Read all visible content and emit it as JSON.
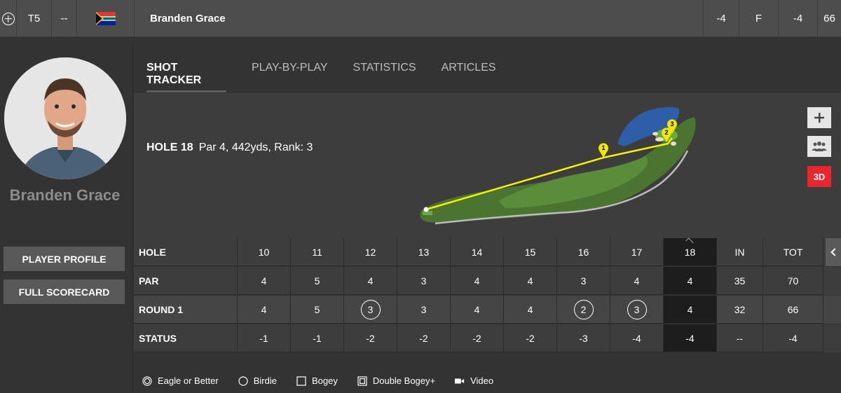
{
  "topbar": {
    "position": "T5",
    "movement": "--",
    "flag_icon": "south-africa-flag-icon",
    "player_name": "Branden Grace",
    "today": "-4",
    "thru": "F",
    "total": "-4",
    "strokes": "66"
  },
  "sidebar": {
    "player_name": "Branden Grace",
    "profile_button": "PLAYER PROFILE",
    "scorecard_button": "FULL SCORECARD"
  },
  "tabs": [
    "SHOT TRACKER",
    "PLAY-BY-PLAY",
    "STATISTICS",
    "ARTICLES"
  ],
  "hole": {
    "label": "HOLE 18",
    "details": "Par 4, 442yds, Rank: 3",
    "shot_markers": [
      "1",
      "2",
      "3"
    ]
  },
  "controls": {
    "three_d_label": "3D"
  },
  "scorecard": {
    "headers": [
      "HOLE",
      "10",
      "11",
      "12",
      "13",
      "14",
      "15",
      "16",
      "17",
      "18",
      "IN",
      "TOT"
    ],
    "rows": [
      {
        "label": "PAR",
        "cells": [
          "4",
          "5",
          "4",
          "3",
          "4",
          "4",
          "3",
          "4",
          "4",
          "35",
          "70"
        ]
      },
      {
        "label": "ROUND 1",
        "cells": [
          "4",
          "5",
          "3",
          "3",
          "4",
          "4",
          "2",
          "3",
          "4",
          "32",
          "66"
        ]
      },
      {
        "label": "STATUS",
        "cells": [
          "-1",
          "-1",
          "-2",
          "-2",
          "-2",
          "-2",
          "-3",
          "-4",
          "-4",
          "--",
          "-4"
        ]
      }
    ],
    "birdie_cells": [
      "12",
      "16",
      "17"
    ]
  },
  "legend": [
    "Eagle or Better",
    "Birdie",
    "Bogey",
    "Double Bogey+",
    "Video"
  ],
  "colors": {
    "accent_red": "#e8262d",
    "shot_line": "#f2f200",
    "fairway": "#4f7c35"
  }
}
